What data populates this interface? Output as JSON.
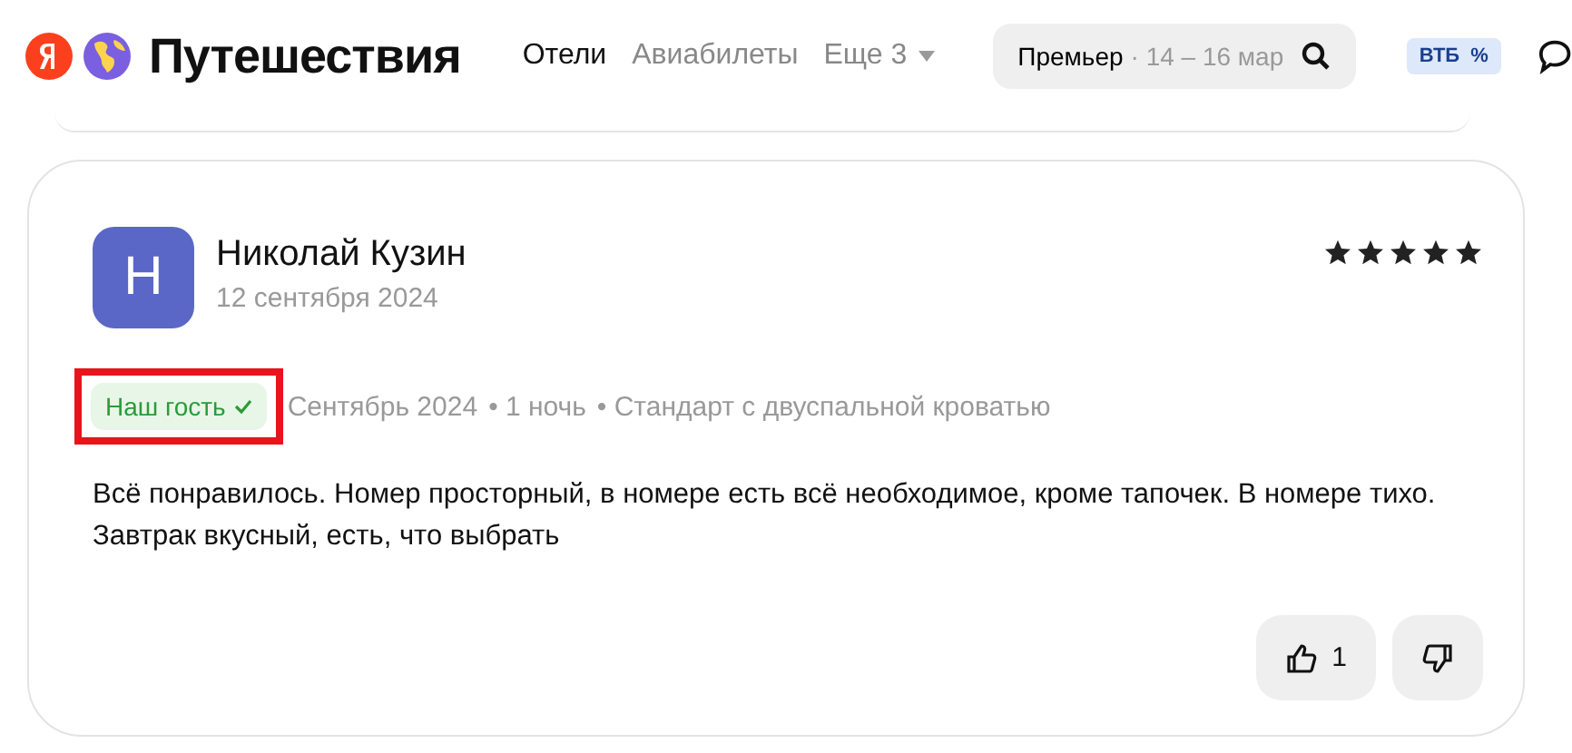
{
  "header": {
    "brand": "Путешествия",
    "nav": [
      {
        "label": "Отели",
        "selected": true
      },
      {
        "label": "Авиабилеты",
        "selected": false
      },
      {
        "label": "Еще 3",
        "selected": false
      }
    ],
    "search": {
      "value": "Премьер",
      "dates": "· 14 – 16 мар"
    },
    "bank_badge": {
      "label": "ВТБ",
      "suffix": "%"
    }
  },
  "review": {
    "avatar_letter": "Н",
    "author": "Николай Кузин",
    "date": "12 сентября 2024",
    "stars": 5,
    "guest_badge": {
      "label": "Наш гость",
      "highlighted": true
    },
    "meta": [
      "Сентябрь 2024",
      "• 1 ночь",
      "• Стандарт с двуспальной кроватью"
    ],
    "text": "Всё понравилось. Номер просторный, в номере есть всё необходимое, кроме тапочек. В номере тихо. Завтрак вкусный, есть, что выбрать",
    "likes": "1"
  }
}
